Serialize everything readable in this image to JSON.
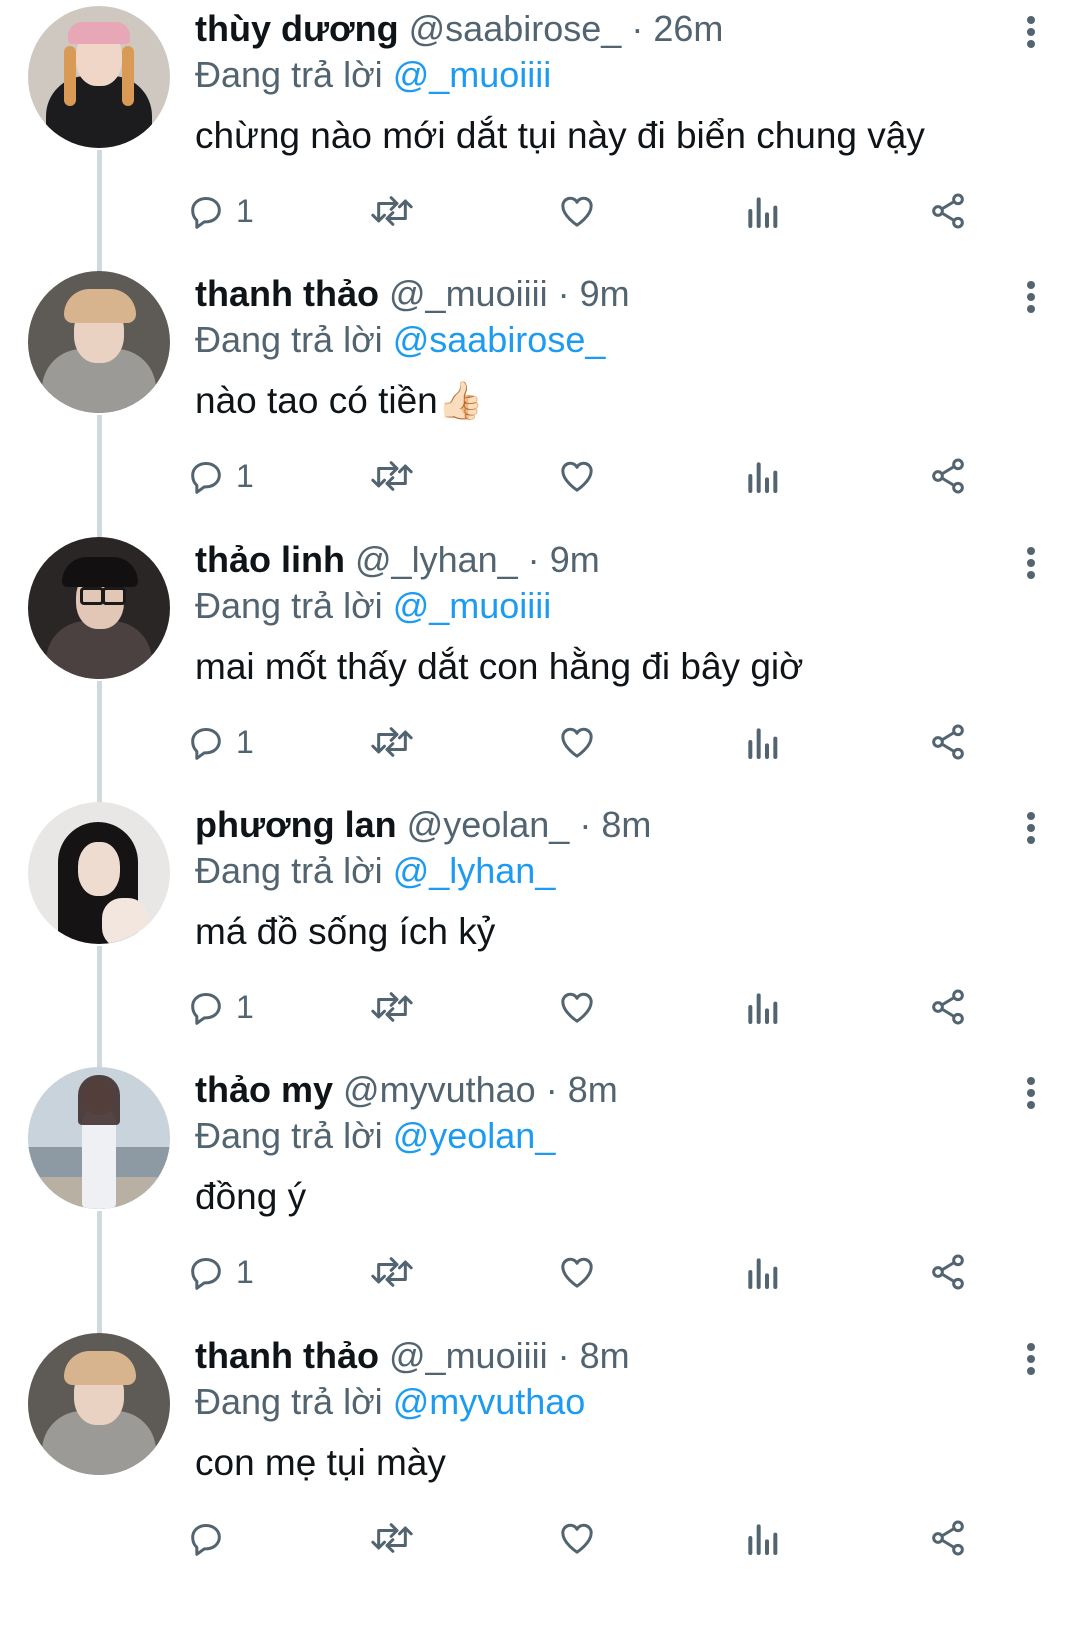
{
  "replying_prefix": "Đang trả lời",
  "dot": "·",
  "colors": {
    "accent": "#1d9bf0",
    "muted": "#536471",
    "text": "#0f1419",
    "thread_line": "#cfd9de"
  },
  "icons": [
    "reply-icon",
    "retweet-icon",
    "like-icon",
    "views-icon",
    "share-icon",
    "more-icon"
  ],
  "tweets": [
    {
      "name": "thùy dương",
      "handle": "@saabirose_",
      "time": "26m",
      "reply_to": "@_muoiiii",
      "text": "chừng nào mới dắt tụi này đi biển chung vậy",
      "reply_count": "1"
    },
    {
      "name": "thanh thảo",
      "handle": "@_muoiiii",
      "time": "9m",
      "reply_to": "@saabirose_",
      "text": "nào tao có tiền👍🏻",
      "reply_count": "1"
    },
    {
      "name": "thảo linh",
      "handle": "@_lyhan_",
      "time": "9m",
      "reply_to": "@_muoiiii",
      "text": "mai mốt thấy dắt con hằng đi bây giờ",
      "reply_count": "1"
    },
    {
      "name": "phương lan",
      "handle": "@yeolan_",
      "time": "8m",
      "reply_to": "@_lyhan_",
      "text": "má đồ sống ích kỷ",
      "reply_count": "1"
    },
    {
      "name": "thảo my",
      "handle": "@myvuthao",
      "time": "8m",
      "reply_to": "@yeolan_",
      "text": "đồng ý",
      "reply_count": "1"
    },
    {
      "name": "thanh thảo",
      "handle": "@_muoiiii",
      "time": "8m",
      "reply_to": "@myvuthao",
      "text": "con mẹ tụi mày",
      "reply_count": ""
    }
  ]
}
